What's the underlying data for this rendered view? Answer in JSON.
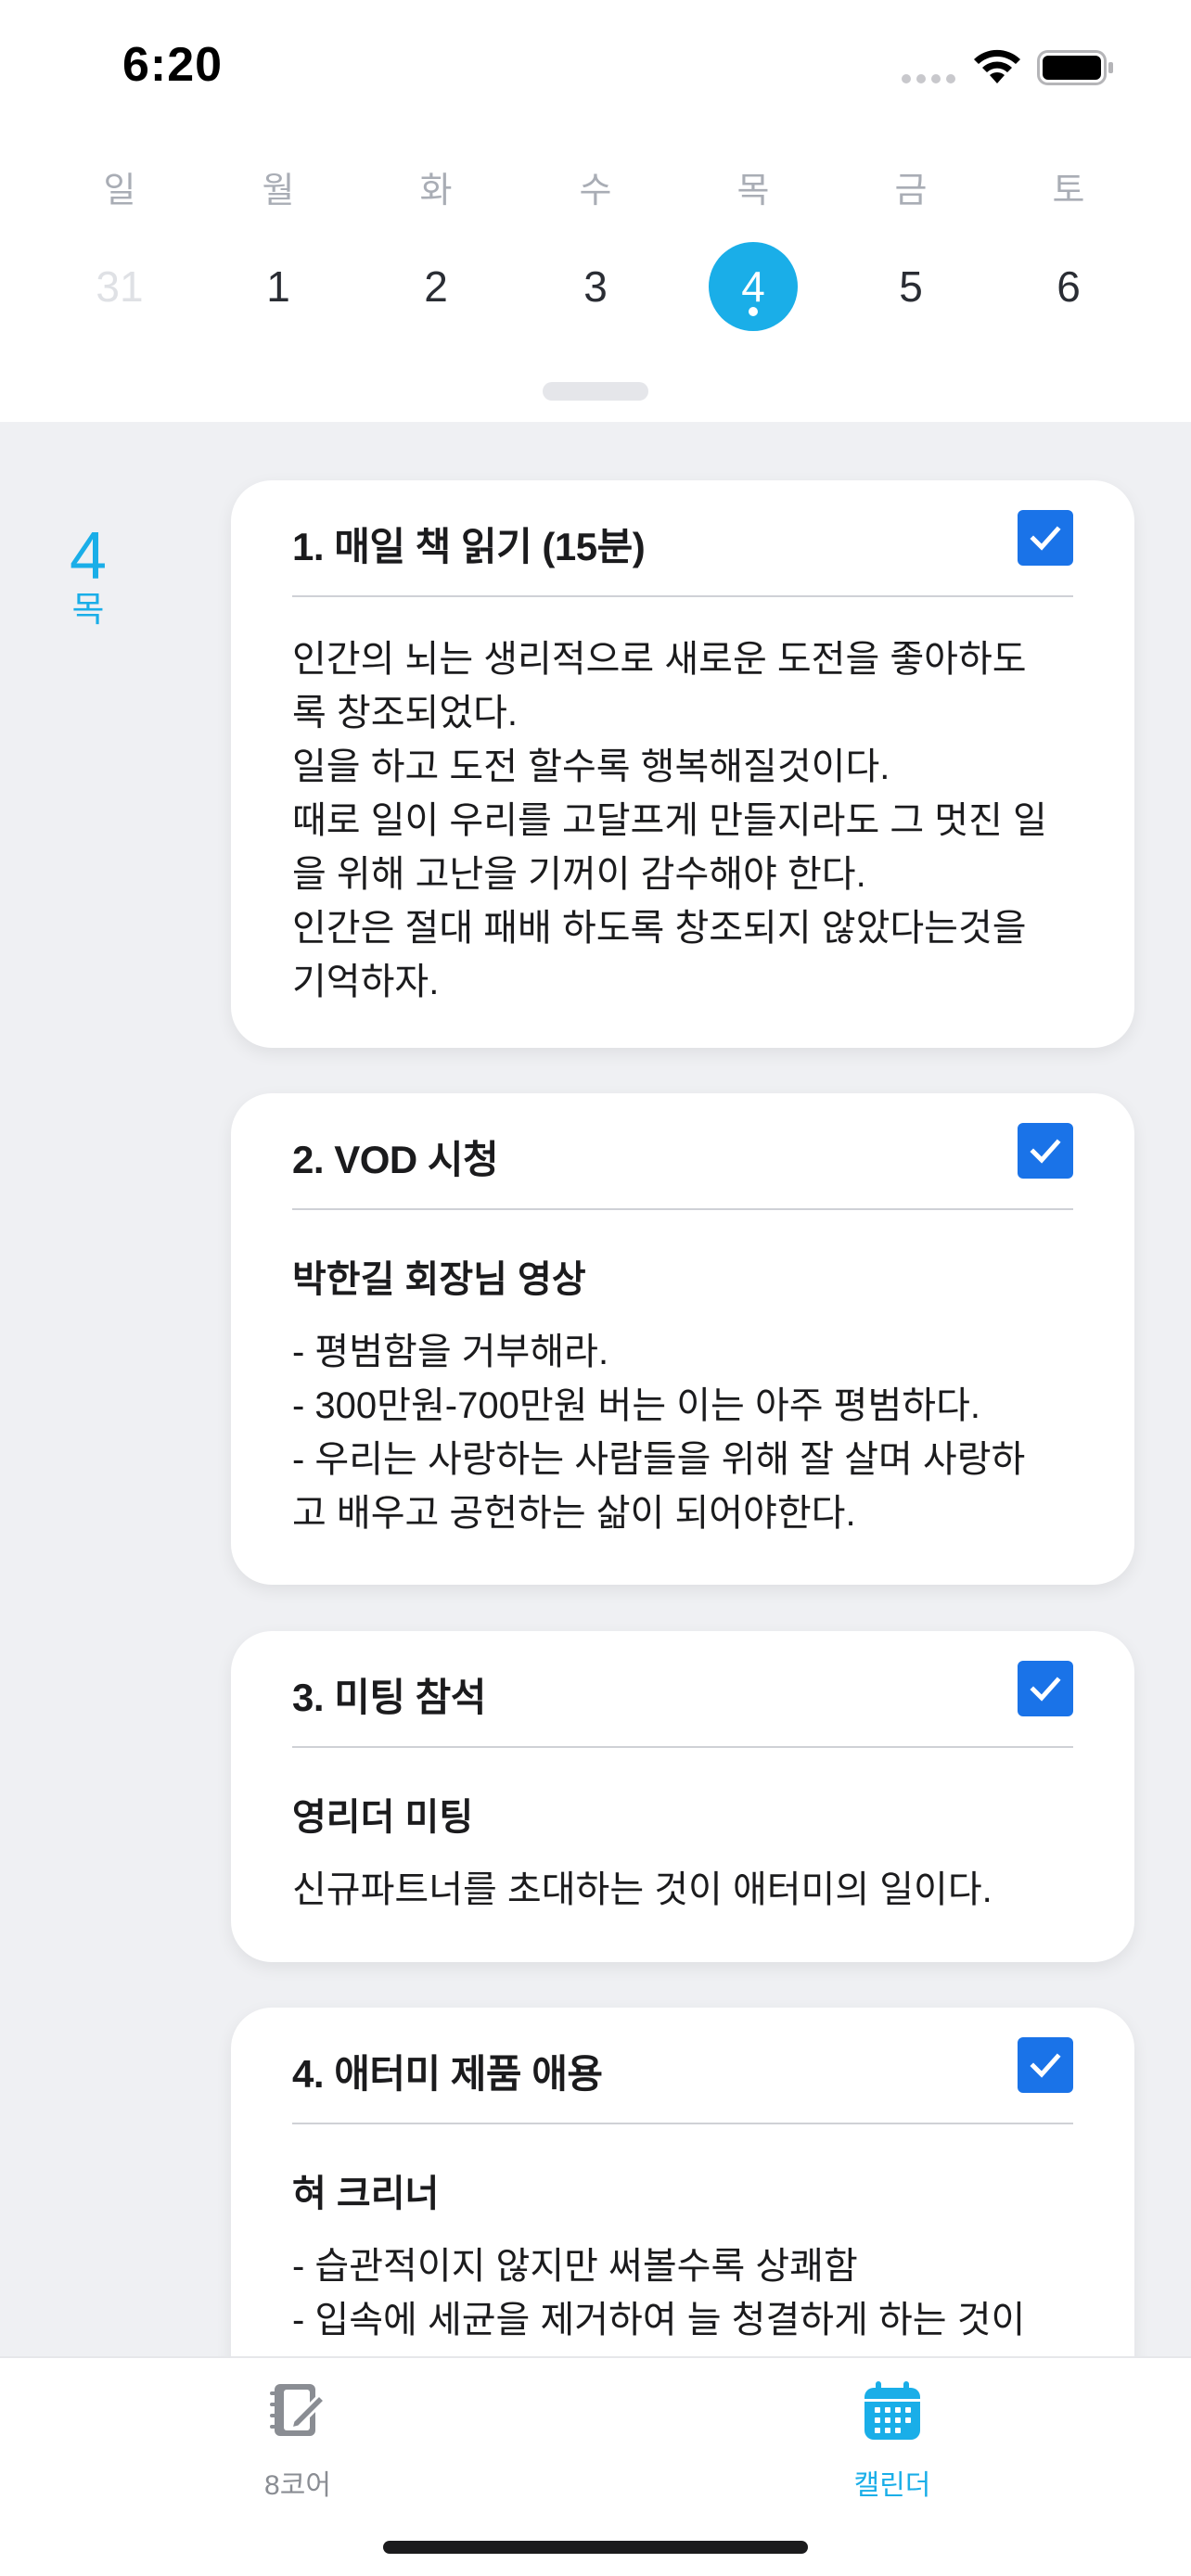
{
  "status_bar": {
    "time": "6:20"
  },
  "week": {
    "days": [
      {
        "weekday": "일",
        "date": "31",
        "state": "muted"
      },
      {
        "weekday": "월",
        "date": "1",
        "state": "normal"
      },
      {
        "weekday": "화",
        "date": "2",
        "state": "normal"
      },
      {
        "weekday": "수",
        "date": "3",
        "state": "normal"
      },
      {
        "weekday": "목",
        "date": "4",
        "state": "selected"
      },
      {
        "weekday": "금",
        "date": "5",
        "state": "normal"
      },
      {
        "weekday": "토",
        "date": "6",
        "state": "normal"
      }
    ]
  },
  "date_label": {
    "day": "4",
    "weekday": "목"
  },
  "cards": [
    {
      "title": "1. 매일 책 읽기 (15분)",
      "checked": true,
      "subtitle": "",
      "lines": [
        "인간의 뇌는 생리적으로 새로운 도전을 좋아하도",
        "록 창조되었다.",
        "일을 하고 도전 할수록 행복해질것이다.",
        "때로 일이 우리를 고달프게 만들지라도 그 멋진 일",
        "을 위해 고난을 기꺼이 감수해야 한다.",
        "인간은 절대 패배 하도록 창조되지 않았다는것을",
        "기억하자."
      ]
    },
    {
      "title": "2. VOD 시청",
      "checked": true,
      "subtitle": "박한길 회장님 영상",
      "lines": [
        "- 평범함을 거부해라.",
        "- 300만원-700만원 버는 이는 아주 평범하다.",
        "- 우리는 사랑하는 사람들을 위해 잘 살며 사랑하",
        "고 배우고 공헌하는 삶이 되어야한다."
      ]
    },
    {
      "title": "3. 미팅 참석",
      "checked": true,
      "subtitle": "영리더 미팅",
      "lines": [
        "신규파트너를 초대하는 것이 애터미의 일이다."
      ]
    },
    {
      "title": "4. 애터미 제품 애용",
      "checked": true,
      "subtitle": "혀 크리너",
      "lines": [
        "- 습관적이지 않지만 써볼수록 상쾌함",
        "- 입속에 세균을 제거하여 늘 청결하게 하는 것이"
      ]
    }
  ],
  "tabbar": {
    "tabs": [
      {
        "label": "8코어",
        "icon": "notebook-edit-icon",
        "active": false
      },
      {
        "label": "캘린더",
        "icon": "calendar-icon",
        "active": true
      }
    ]
  },
  "colors": {
    "accent": "#1aaee8",
    "checkbox": "#1a73e8",
    "background": "#eff0f3"
  }
}
